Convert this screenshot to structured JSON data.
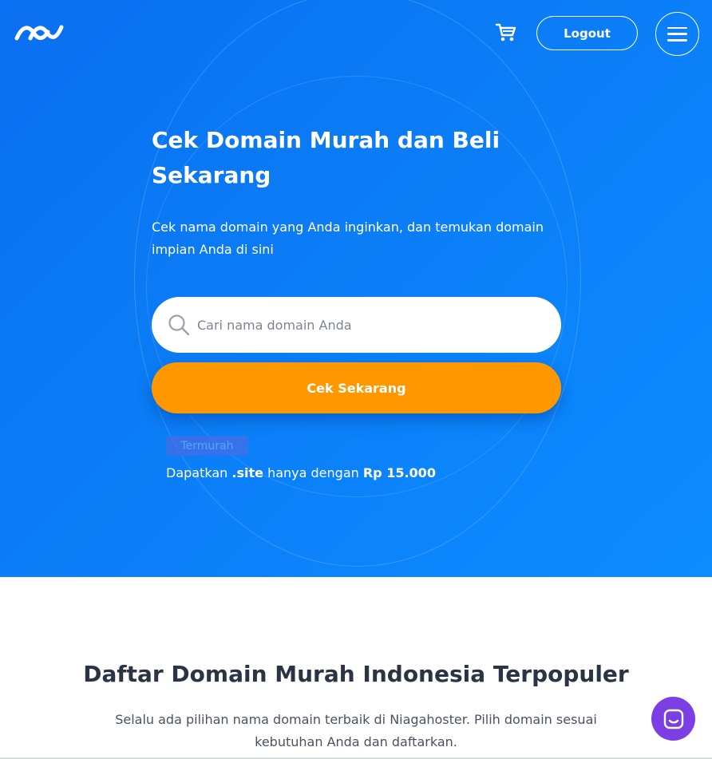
{
  "header": {
    "logo_icon": "niagahoster-wave-logo",
    "cart_icon": "shopping-cart-icon",
    "logout_label": "Logout",
    "menu_icon": "hamburger-menu-icon"
  },
  "hero": {
    "title": "Cek Domain Murah dan Beli Sekarang",
    "subtitle": "Cek nama domain yang Anda inginkan, dan temukan domain impian Anda di sini",
    "search": {
      "icon": "search-icon",
      "placeholder": "Cari nama domain Anda",
      "value": ""
    },
    "check_button_label": "Cek Sekarang",
    "badge": "Termurah",
    "promo": {
      "prefix": "Dapatkan",
      "tld": ".site",
      "middle": "hanya dengan",
      "price": "Rp 15.000"
    }
  },
  "section": {
    "title": "Daftar Domain Murah Indonesia Terpopuler",
    "subtitle": "Selalu ada pilihan nama domain terbaik di Niagahoster. Pilih domain sesuai kebutuhan Anda dan daftarkan."
  },
  "chat": {
    "icon": "chat-icon"
  },
  "colors": {
    "hero_gradient_start": "#0a6ff0",
    "hero_gradient_end": "#0c8cff",
    "accent_orange": "#ff9800",
    "chat_purple": "#7b3fe4",
    "heading_dark": "#2b3445"
  }
}
